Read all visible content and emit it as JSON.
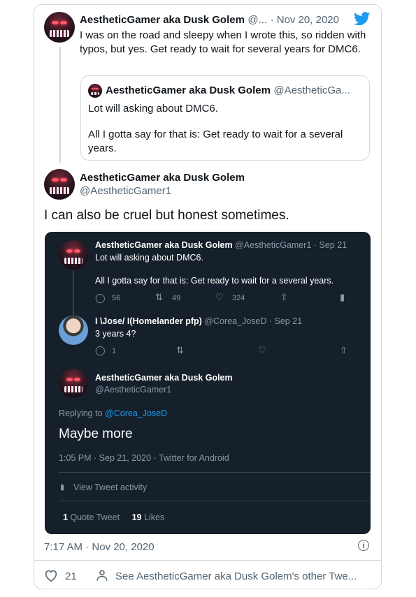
{
  "tweet_top": {
    "name": "AestheticGamer aka Dusk Golem",
    "handle": "@...",
    "date": "· Nov 20, 2020",
    "text": "I was on the road and sleepy when I wrote this, so ridden with typos, but yes. Get ready to wait for several years for DMC6."
  },
  "quoted": {
    "name": "AestheticGamer aka Dusk Golem",
    "handle": "@AestheticGa...",
    "line1": "Lot will asking about DMC6.",
    "line2": "All I gotta say for that is: Get ready to wait for a several years."
  },
  "main": {
    "name": "AestheticGamer aka Dusk Golem",
    "handle": "@AestheticGamer1",
    "text": "I can also be cruel but honest sometimes.",
    "time": "7:17 AM · Nov 20, 2020",
    "likes": "21",
    "see_more": "See AestheticGamer aka Dusk Golem's other Twe..."
  },
  "screenshot": {
    "t1": {
      "name": "AestheticGamer aka Dusk Golem",
      "meta": "@AestheticGamer1 · Sep 21",
      "line1": "Lot will asking about DMC6.",
      "line2": "All I gotta say for that is: Get ready to wait for a several years.",
      "replies": "56",
      "retweets": "49",
      "likes": "324"
    },
    "t2": {
      "name": "I \\Jose/ I(Homelander pfp)",
      "meta": "@Corea_JoseD · Sep 21",
      "text": "3 years 4?",
      "replies": "1"
    },
    "t3": {
      "name": "AestheticGamer aka Dusk Golem",
      "handle": "@AestheticGamer1",
      "replying_prefix": "Replying to",
      "replying_to": "@Corea_JoseD",
      "text": "Maybe more",
      "meta": "1:05 PM · Sep 21, 2020 · Twitter for Android",
      "activity": "View Tweet activity",
      "quote_count": "1",
      "quote_label": "Quote Tweet",
      "likes_count": "19",
      "likes_label": "Likes"
    }
  },
  "colors": {
    "accent": "#1d9bf0",
    "dark_bg": "#15202b"
  }
}
